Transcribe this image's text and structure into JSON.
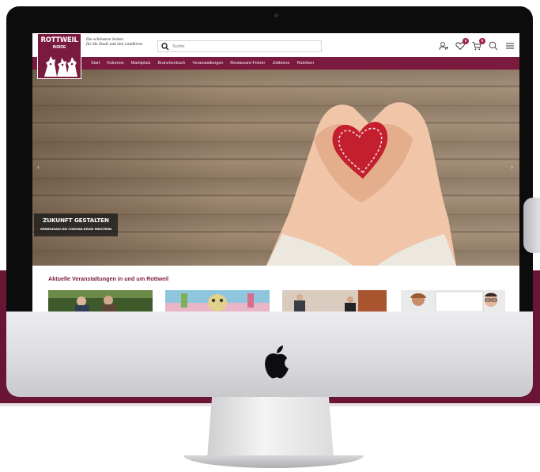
{
  "logo": {
    "title": "ROTTWEIL",
    "subtitle": "INSIDE"
  },
  "tagline": {
    "line1": "Die schönsten Seiten",
    "line2": "für die Stadt und den Landkreis"
  },
  "search": {
    "placeholder": "Suche"
  },
  "header_icons": {
    "account": {
      "icon": "user-plus-icon"
    },
    "wishlist": {
      "icon": "heart-icon",
      "count": "0"
    },
    "cart": {
      "icon": "cart-icon",
      "count": "0"
    },
    "search": {
      "icon": "search-icon"
    },
    "menu": {
      "icon": "hamburger-icon"
    }
  },
  "nav": [
    {
      "label": "Start"
    },
    {
      "label": "Kolumne"
    },
    {
      "label": "Marktplatz"
    },
    {
      "label": "Branchenbuch"
    },
    {
      "label": "Veranstaltungen"
    },
    {
      "label": "Restaurant-Führer"
    },
    {
      "label": "Jobbörse"
    },
    {
      "label": "Rubriken"
    }
  ],
  "hero": {
    "title": "ZUKUNFT GESTALTEN",
    "subtitle": "GEMEINSAM DIE CORONA-KRISE MEISTERN"
  },
  "events": {
    "title": "Aktuelle Veranstaltungen in und um Rottweil"
  },
  "colors": {
    "brand": "#7b1a3f",
    "background_band": "#6b1536",
    "badge": "#a01e4f"
  }
}
